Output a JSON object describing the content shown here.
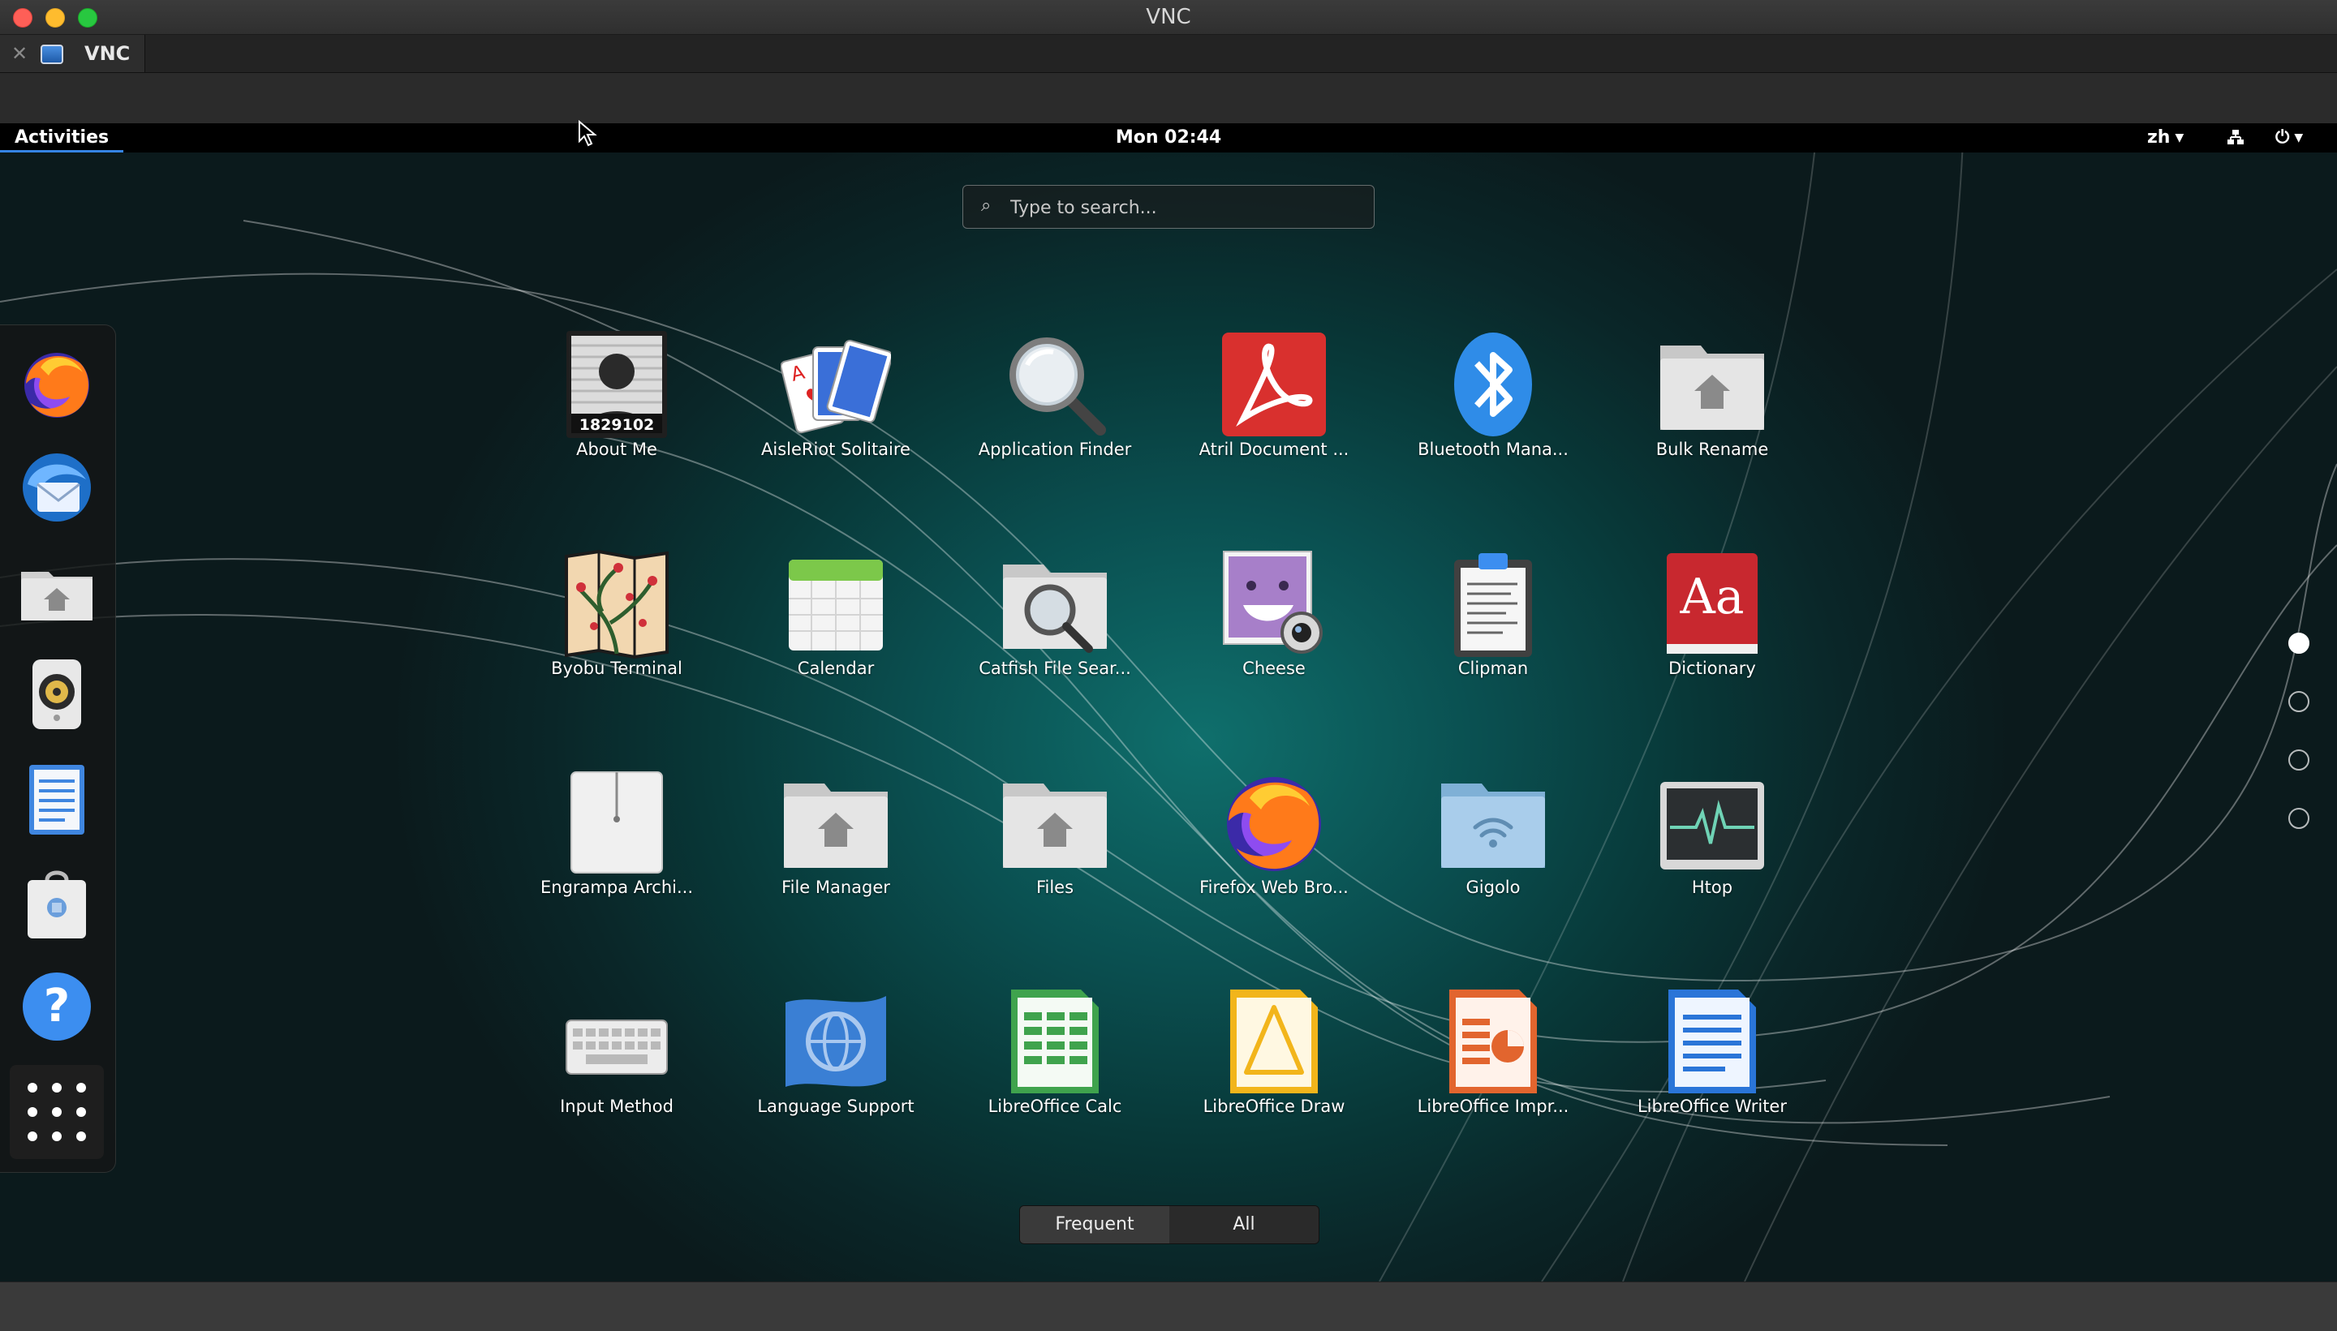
{
  "window": {
    "title": "VNC"
  },
  "tabs": [
    {
      "label": "VNC"
    }
  ],
  "topbar": {
    "activities": "Activities",
    "clock": "Mon 02:44",
    "language": "zh"
  },
  "search": {
    "placeholder": "Type to search..."
  },
  "dash": {
    "items": [
      {
        "icon": "firefox-icon"
      },
      {
        "icon": "thunderbird-icon"
      },
      {
        "icon": "home-folder-icon"
      },
      {
        "icon": "speaker-icon"
      },
      {
        "icon": "text-editor-icon"
      },
      {
        "icon": "software-center-icon"
      },
      {
        "icon": "help-icon"
      },
      {
        "icon": "show-apps-icon"
      }
    ]
  },
  "apps": [
    {
      "label": "About Me",
      "icon": "about-me-icon",
      "badge": "1829102"
    },
    {
      "label": "AisleRiot Solitaire",
      "icon": "cards-icon"
    },
    {
      "label": "Application Finder",
      "icon": "magnifier-icon"
    },
    {
      "label": "Atril Document ...",
      "icon": "pdf-icon"
    },
    {
      "label": "Bluetooth Mana...",
      "icon": "bluetooth-icon"
    },
    {
      "label": "Bulk Rename",
      "icon": "folder-home-icon"
    },
    {
      "label": "Byobu Terminal",
      "icon": "byobu-icon"
    },
    {
      "label": "Calendar",
      "icon": "calendar-icon"
    },
    {
      "label": "Catfish File Sear...",
      "icon": "folder-search-icon"
    },
    {
      "label": "Cheese",
      "icon": "cheese-icon"
    },
    {
      "label": "Clipman",
      "icon": "clipboard-icon"
    },
    {
      "label": "Dictionary",
      "icon": "dictionary-icon",
      "glyph": "Aa"
    },
    {
      "label": "Engrampa Archi...",
      "icon": "archive-icon"
    },
    {
      "label": "File Manager",
      "icon": "folder-home-icon"
    },
    {
      "label": "Files",
      "icon": "folder-home-icon"
    },
    {
      "label": "Firefox Web Bro...",
      "icon": "firefox-icon"
    },
    {
      "label": "Gigolo",
      "icon": "folder-network-icon"
    },
    {
      "label": "Htop",
      "icon": "htop-icon"
    },
    {
      "label": "Input Method",
      "icon": "keyboard-icon"
    },
    {
      "label": "Language Support",
      "icon": "language-icon"
    },
    {
      "label": "LibreOffice Calc",
      "icon": "calc-icon"
    },
    {
      "label": "LibreOffice Draw",
      "icon": "draw-icon"
    },
    {
      "label": "LibreOffice Impr...",
      "icon": "impress-icon"
    },
    {
      "label": "LibreOffice Writer",
      "icon": "writer-icon"
    }
  ],
  "pages": {
    "count": 4,
    "current": 1
  },
  "view_switcher": {
    "frequent": "Frequent",
    "all": "All",
    "selected": "All"
  },
  "colors": {
    "accent": "#3584e4",
    "desktop_teal": "#0f6f6c",
    "panel": "#000000"
  }
}
